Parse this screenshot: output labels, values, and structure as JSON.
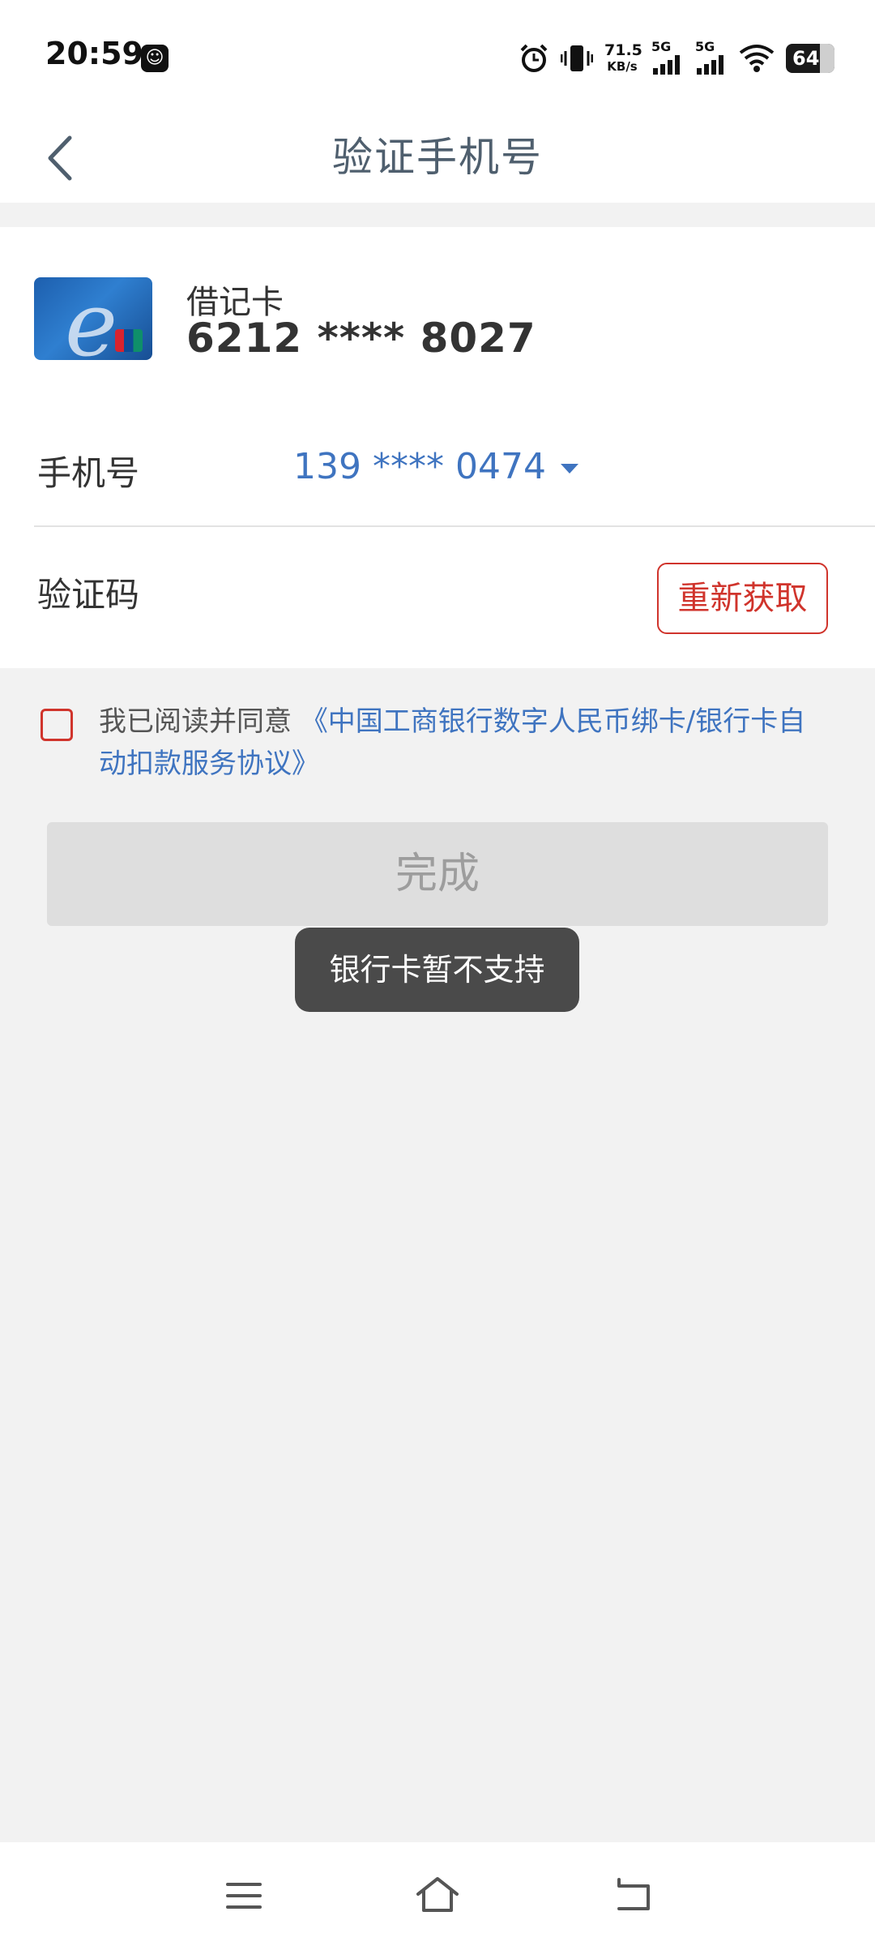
{
  "status_bar": {
    "time": "20:59",
    "net_speed_value": "71.5",
    "net_speed_unit": "KB/s",
    "signal1_label": "5G",
    "signal2_label": "5G",
    "battery": "64"
  },
  "header": {
    "title": "验证手机号"
  },
  "card": {
    "type": "借记卡",
    "number": "6212 **** 8027"
  },
  "form": {
    "phone_label": "手机号",
    "phone_value": "139 **** 0474",
    "code_label": "验证码",
    "code_placeholder": "",
    "resend_label": "重新获取"
  },
  "agreement": {
    "prefix": "我已阅读并同意 ",
    "link": "《中国工商银行数字人民币绑卡/银行卡自动扣款服务协议》"
  },
  "done_label": "完成",
  "toast": "银行卡暂不支持",
  "colors": {
    "accent_blue": "#3f74c0",
    "accent_red": "#d0342c",
    "title_gray": "#4f5f6e"
  }
}
